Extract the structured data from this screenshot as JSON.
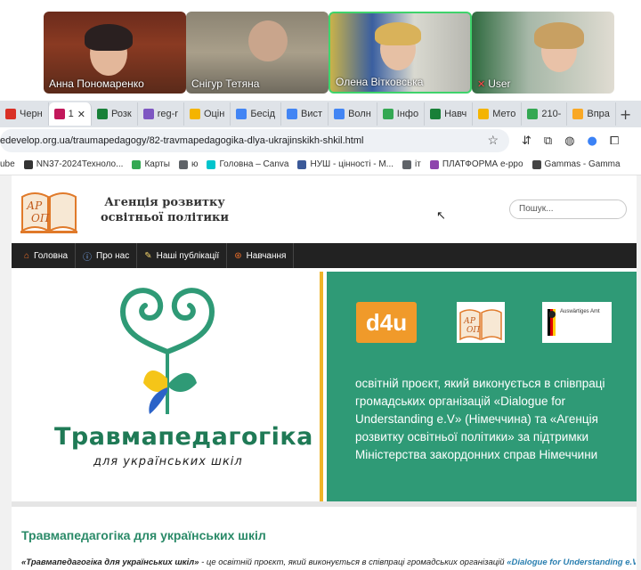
{
  "call": {
    "participants": [
      {
        "name": "Анна Пономаренко",
        "mic_off": false
      },
      {
        "name": "Снігур Тетяна",
        "mic_off": false
      },
      {
        "name": "Олена Вітковська",
        "mic_off": false
      },
      {
        "name": "User",
        "mic_off": true
      }
    ]
  },
  "tabs": [
    {
      "label": "Черн",
      "icon": "gmail-icon",
      "color": "#d93025"
    },
    {
      "label": "1",
      "icon": "record-icon",
      "color": "#c2185b",
      "active": true
    },
    {
      "label": "Розк",
      "icon": "sheets-icon",
      "color": "#188038"
    },
    {
      "label": "reg-r",
      "icon": "form-icon",
      "color": "#7e57c2"
    },
    {
      "label": "Оцін",
      "icon": "slides-icon",
      "color": "#f4b400"
    },
    {
      "label": "Бесід",
      "icon": "docs-icon",
      "color": "#4285f4"
    },
    {
      "label": "Вист",
      "icon": "docs-icon",
      "color": "#4285f4"
    },
    {
      "label": "Волн",
      "icon": "docs-icon",
      "color": "#4285f4"
    },
    {
      "label": "Інфо",
      "icon": "drive-icon",
      "color": "#34a853"
    },
    {
      "label": "Навч",
      "icon": "sheets-icon",
      "color": "#188038"
    },
    {
      "label": "Мето",
      "icon": "slides-icon",
      "color": "#f4b400"
    },
    {
      "label": "210-",
      "icon": "drive-icon",
      "color": "#34a853"
    },
    {
      "label": "Впра",
      "icon": "alert-icon",
      "color": "#f9a825"
    }
  ],
  "address": {
    "url": "edevelop.org.ua/traumapedagogy/82-travmapedagogika-dlya-ukrajinskikh-shkil.html"
  },
  "bookmarks": [
    {
      "label": "ube",
      "color": "#ff0000"
    },
    {
      "label": "NN37-2024Техноло...",
      "color": "#333333"
    },
    {
      "label": "Карты",
      "color": "#34a853"
    },
    {
      "label": "ю",
      "color": "#5f6368"
    },
    {
      "label": "Головна – Canva",
      "color": "#00c4cc"
    },
    {
      "label": "НУШ - цінності - М...",
      "color": "#3b5998"
    },
    {
      "label": "іт",
      "color": "#5f6368"
    },
    {
      "label": "ПЛАТФОРМА e-ppo",
      "color": "#8e44ad"
    },
    {
      "label": "Gammas - Gamma",
      "color": "#444444"
    }
  ],
  "site": {
    "agency_name": "Агенція розвитку освітньої політики",
    "logo_text": "АР ОП",
    "search_placeholder": "Пошук...",
    "nav": [
      {
        "label": "Головна",
        "icon": "home-icon"
      },
      {
        "label": "Про нас",
        "icon": "info-icon"
      },
      {
        "label": "Наші публікації",
        "icon": "edit-icon"
      },
      {
        "label": "Навчання",
        "icon": "lifebuoy-icon"
      }
    ],
    "banner": {
      "title": "Травмапедагогіка",
      "subtitle": "для українських шкіл",
      "partner_d4u": "d4u",
      "partner_aa": "Auswärtiges Amt",
      "text": "освітній проєкт, який виконується в співпраці громадських організацій «Dialogue for Understanding e.V» (Німеччина) та «Агенція розвитку освітньої політики» за підтримки  Міністерства закордонних справ Німеччини"
    },
    "content": {
      "heading": "Травмапедагогіка для українських шкіл",
      "lead_bold": "«Травмапедагогіка для українських шкіл»",
      "lead_text": " - це освітній проєкт, який виконується в співпраці громадських організацій ",
      "lead_link": "«Dialogue for Understanding e.V»"
    }
  },
  "colors": {
    "brand_green": "#2f9a76",
    "accent_yellow": "#f0b429",
    "nav_dark": "#222222"
  }
}
